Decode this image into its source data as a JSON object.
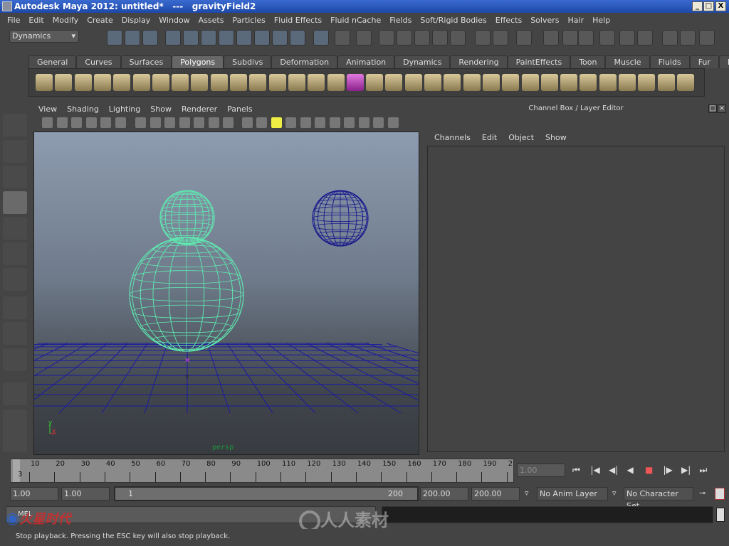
{
  "title": "Autodesk Maya 2012: untitled*   ---   gravityField2",
  "window_buttons": [
    "_",
    "□",
    "X"
  ],
  "menu": [
    "File",
    "Edit",
    "Modify",
    "Create",
    "Display",
    "Window",
    "Assets",
    "Particles",
    "Fluid Effects",
    "Fluid nCache",
    "Fields",
    "Soft/Rigid Bodies",
    "Effects",
    "Solvers",
    "Hair",
    "Help"
  ],
  "status_line": {
    "mode": "Dynamics"
  },
  "shelf_tabs": [
    "General",
    "Curves",
    "Surfaces",
    "Polygons",
    "Subdivs",
    "Deformation",
    "Animation",
    "Dynamics",
    "Rendering",
    "PaintEffects",
    "Toon",
    "Muscle",
    "Fluids",
    "Fur",
    "Hair"
  ],
  "active_shelf_tab": "Polygons",
  "viewport": {
    "menu": [
      "View",
      "Shading",
      "Lighting",
      "Show",
      "Renderer",
      "Panels"
    ],
    "camera_label": "persp",
    "axis_y": "y",
    "axis_x": "x"
  },
  "channel_box": {
    "title": "Channel Box / Layer Editor",
    "menu": [
      "Channels",
      "Edit",
      "Object",
      "Show"
    ]
  },
  "timeline": {
    "ticks": [
      "10",
      "20",
      "30",
      "40",
      "50",
      "60",
      "70",
      "80",
      "90",
      "100",
      "110",
      "120",
      "130",
      "140",
      "150",
      "160",
      "170",
      "180",
      "190",
      "2"
    ],
    "current_frame_marker": "3",
    "current_time": "1.00"
  },
  "range": {
    "start": "1.00",
    "playback_start": "1.00",
    "slider_start": "1",
    "slider_end": "200",
    "playback_end": "200.00",
    "end": "200.00",
    "anim_layer": "No Anim Layer",
    "character_set": "No Character Set"
  },
  "command_line": {
    "label": "MEL"
  },
  "help_line": "Stop playback.  Pressing the ESC key will also stop playback.",
  "watermarks": [
    "火星时代",
    "人人素材"
  ],
  "colors": {
    "wire_selected": "#5fe8b0",
    "wire_unselected": "#1a1a8c",
    "grid": "#1a1aa0",
    "titlebar": "#2456bd"
  }
}
